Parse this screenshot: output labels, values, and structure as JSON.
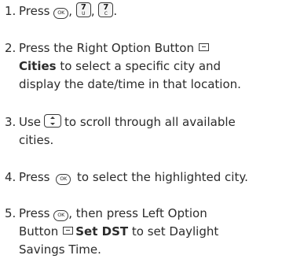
{
  "steps": [
    {
      "number": "1.",
      "text_press": "Press",
      "sep1": ",",
      "sep2": ",",
      "end": ".",
      "keys": {
        "ok": "OK",
        "key1_top": "7",
        "key1_bottom": "U",
        "key2_top": "7",
        "key2_bottom": "C"
      }
    },
    {
      "number": "2.",
      "line1": "Press the Right Option Button",
      "bold": "Cities",
      "line2_rest": " to select a specific city and",
      "line3": "display the date/time in that location."
    },
    {
      "number": "3.",
      "before": "Use",
      "after": "to scroll through all available",
      "line2": "cities."
    },
    {
      "number": "4.",
      "before": "Press",
      "ok": "OK",
      "after": "to select the highlighted city."
    },
    {
      "number": "5.",
      "before": "Press",
      "ok": "OK",
      "after": ", then press Left Option",
      "line2_before": "Button",
      "bold": "Set DST",
      "line2_after": " to set Daylight",
      "line3": "Savings Time."
    }
  ]
}
